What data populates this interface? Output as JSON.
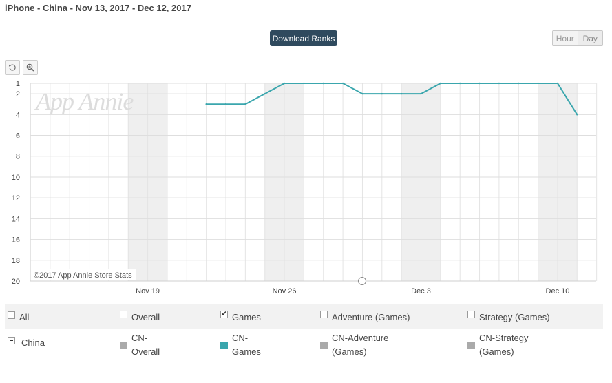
{
  "header": {
    "title": "iPhone - China - Nov 13, 2017 - Dec 12, 2017",
    "download_label": "Download Ranks",
    "granularity": [
      "Hour",
      "Day"
    ]
  },
  "toolbar": {
    "reset_icon": "reset-icon",
    "zoom_icon": "zoom-icon"
  },
  "watermark": "App Annie",
  "copyright": "©2017 App Annie Store Stats",
  "chart_data": {
    "type": "line",
    "x_tick_labels": [
      "Nov 19",
      "Nov 26",
      "Dec 3",
      "Dec 10"
    ],
    "y_tick_labels": [
      "1",
      "2",
      "4",
      "6",
      "8",
      "10",
      "12",
      "14",
      "16",
      "18",
      "20"
    ],
    "y_range": [
      1,
      20
    ],
    "y_inverted": true,
    "x_range": [
      "Nov 13",
      "Dec 12"
    ],
    "grid": true,
    "weekend_bands": true,
    "series": [
      {
        "name": "CN-Games",
        "color": "#3aa6ad",
        "x": [
          "Nov 22",
          "Nov 23",
          "Nov 24",
          "Nov 25",
          "Nov 26",
          "Nov 27",
          "Nov 28",
          "Nov 29",
          "Nov 30",
          "Dec 1",
          "Dec 2",
          "Dec 3",
          "Dec 4",
          "Dec 5",
          "Dec 6",
          "Dec 7",
          "Dec 8",
          "Dec 9",
          "Dec 10",
          "Dec 11"
        ],
        "values": [
          3,
          3,
          3,
          2,
          1,
          1,
          1,
          1,
          2,
          2,
          2,
          2,
          1,
          1,
          1,
          1,
          1,
          1,
          1,
          4
        ]
      }
    ]
  },
  "legend": {
    "row1": [
      {
        "label": "All",
        "checked": false
      },
      {
        "label": "Overall",
        "checked": false
      },
      {
        "label": "Games",
        "checked": true
      },
      {
        "label": "Adventure (Games)",
        "checked": false
      },
      {
        "label": "Strategy (Games)",
        "checked": false
      }
    ],
    "row2_country": "China",
    "row2": [
      {
        "line1": "CN-",
        "line2": "Overall",
        "color": "#aaaaaa"
      },
      {
        "line1": "CN-",
        "line2": "Games",
        "color": "#3aa6ad"
      },
      {
        "line1": "CN-Adventure",
        "line2": "(Games)",
        "color": "#aaaaaa"
      },
      {
        "line1": "CN-Strategy",
        "line2": "(Games)",
        "color": "#aaaaaa"
      }
    ]
  }
}
